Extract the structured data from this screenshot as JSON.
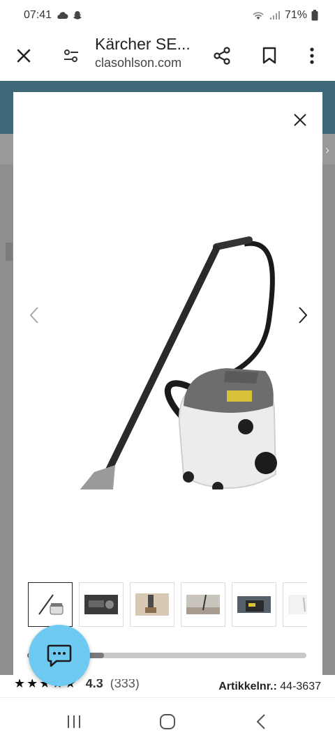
{
  "status_bar": {
    "time": "07:41",
    "battery": "71%"
  },
  "browser": {
    "page_title": "Kärcher SE...",
    "url": "clasohlson.com"
  },
  "product": {
    "rating_value": "4.3",
    "rating_count": "(333)",
    "article_label": "Artikkelnr.:",
    "article_number": "44-3637"
  },
  "gallery": {
    "thumbnail_count": 6,
    "active_index": 0
  },
  "icons": {
    "close": "close-icon",
    "settings": "tune-icon",
    "share": "share-icon",
    "bookmark": "bookmark-icon",
    "menu": "more-vert-icon",
    "chat": "chat-bubble-icon"
  },
  "colors": {
    "header_band": "#3e6877",
    "chat_fab": "#6fcaf2",
    "overlay": "#8e8e8e"
  }
}
